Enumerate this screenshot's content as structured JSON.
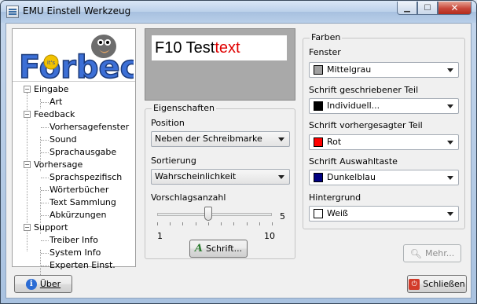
{
  "window": {
    "title": "EMU Einstell Werkzeug"
  },
  "logo": {
    "text": "Forbec",
    "badge": "it's"
  },
  "tree": [
    {
      "label": "Eingabe",
      "level": 0,
      "expander": "−"
    },
    {
      "label": "Art",
      "level": 1
    },
    {
      "label": "Feedback",
      "level": 0,
      "expander": "−"
    },
    {
      "label": "Vorhersagefenster",
      "level": 1
    },
    {
      "label": "Sound",
      "level": 1
    },
    {
      "label": "Sprachausgabe",
      "level": 1
    },
    {
      "label": "Vorhersage",
      "level": 0,
      "expander": "−"
    },
    {
      "label": "Sprachspezifisch",
      "level": 1
    },
    {
      "label": "Wörterbücher",
      "level": 1
    },
    {
      "label": "Text Sammlung",
      "level": 1
    },
    {
      "label": "Abkürzungen",
      "level": 1
    },
    {
      "label": "Support",
      "level": 0,
      "expander": "−"
    },
    {
      "label": "Treiber Info",
      "level": 1
    },
    {
      "label": "System Info",
      "level": 1
    },
    {
      "label": "Experten Einst.",
      "level": 1
    }
  ],
  "preview": {
    "prefix": "F10 Test",
    "prefix_color": "#000000",
    "suffix": "text",
    "suffix_color": "#e00000"
  },
  "eigenschaften": {
    "title": "Eigenschaften",
    "position_label": "Position",
    "position_value": "Neben der Schreibmarke",
    "sortierung_label": "Sortierung",
    "sortierung_value": "Wahrscheinlichkeit",
    "anzahl_label": "Vorschlagsanzahl",
    "slider_value": "5",
    "slider_min": "1",
    "slider_max": "10",
    "slider_value_num": 5,
    "slider_min_num": 1,
    "slider_max_num": 10,
    "font_button": "Schrift..."
  },
  "farben": {
    "title": "Farben",
    "items": [
      {
        "label": "Fenster",
        "value": "Mittelgrau",
        "color": "#a0a0a0"
      },
      {
        "label": "Schrift geschriebener Teil",
        "value": "Individuell...",
        "color": "#000000"
      },
      {
        "label": "Schrift vorhergesagter Teil",
        "value": "Rot",
        "color": "#ff0000"
      },
      {
        "label": "Schrift Auswahltaste",
        "value": "Dunkelblau",
        "color": "#000080"
      },
      {
        "label": "Hintergrund",
        "value": "Weiß",
        "color": "#ffffff"
      }
    ],
    "more_button": "Mehr..."
  },
  "footer": {
    "about_button": "Über",
    "close_button": "Schließen"
  }
}
